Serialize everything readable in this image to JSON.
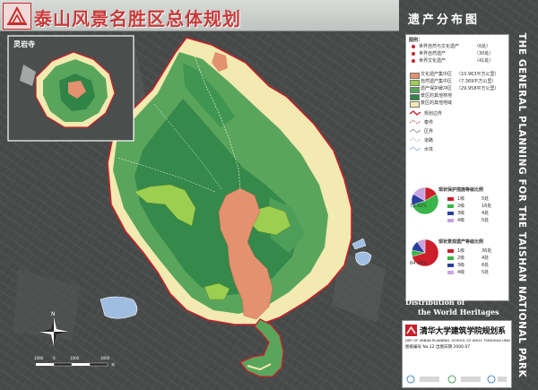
{
  "header": {
    "title": "泰山风景名胜区总体规划",
    "subtitle": "遗产分布图"
  },
  "side_title": "THE GENERAL PLANNING FOR THE TAISHAN NATIONAL PARK",
  "inset": {
    "label": "灵岩寺",
    "temple_label": ""
  },
  "legend": {
    "heading": "图例：",
    "points": [
      {
        "label": "世界自然与文化遗产",
        "count": "（6处）"
      },
      {
        "label": "世界自然遗产",
        "count": "（30处）"
      },
      {
        "label": "世界文化遗产",
        "count": "（41处）"
      }
    ],
    "areas": [
      {
        "label": "文化遗产集中区",
        "value": "（10.963平方公里）",
        "color": "#e3916f"
      },
      {
        "label": "自然遗产集中区",
        "value": "（7.369平方公里）",
        "color": "#9ccf4f"
      },
      {
        "label": "遗产保护缓冲区",
        "value": "（29.958平方公里）",
        "color": "#5aa55c"
      },
      {
        "label": "景区的其他林地",
        "value": "",
        "color": "#2f8446"
      },
      {
        "label": "景区的其他地域",
        "value": "",
        "color": "#f2eab0"
      }
    ],
    "lines": [
      {
        "label": "规划边界",
        "color": "#c8202c"
      },
      {
        "label": "泰界",
        "color": "#b05050"
      },
      {
        "label": "区界",
        "color": "#888888"
      },
      {
        "label": "道路",
        "color": "#999999"
      },
      {
        "label": "水体",
        "color": "#9fbde0"
      }
    ]
  },
  "pie_natural": {
    "title": "现状保护措施等级比例",
    "pct_label_small": "",
    "pct_label_large": "73.42%",
    "rows": [
      {
        "label": "1级",
        "count": "5处",
        "color": "#cc1f2a"
      },
      {
        "label": "2级",
        "count": "16处",
        "color": "#3ab54a"
      },
      {
        "label": "3级",
        "count": "4处",
        "color": "#2b3f9e"
      },
      {
        "label": "4级",
        "count": "5处",
        "color": "#c9a2e0"
      }
    ],
    "slices": [
      0.1667,
      0.5333,
      0.1333,
      0.1667
    ]
  },
  "pie_cultural": {
    "title": "现状景观遗产等级比例",
    "pct_label_small": "",
    "pct_label_large": "64.74%",
    "rows": [
      {
        "label": "1级",
        "count": "36处",
        "color": "#cc1f2a"
      },
      {
        "label": "2级",
        "count": "4处",
        "color": "#3ab54a"
      },
      {
        "label": "3级",
        "count": "6处",
        "color": "#2b3f9e"
      },
      {
        "label": "4级",
        "count": "5处",
        "color": "#c9a2e0"
      }
    ],
    "slices": [
      0.706,
      0.078,
      0.118,
      0.098
    ]
  },
  "caption": {
    "line1": "Distribution of",
    "line2": "the World Heritages"
  },
  "credit": {
    "university": "清华大学建筑学院规划系",
    "department_en": "DEP. OF URBAN PLANNING, SCHOOL OF ARCH. TSINGHUA UNIV",
    "drawing_info": "图纸编号 No.12   出图日期 2000.07"
  },
  "scale": {
    "labels": [
      "1000",
      "0",
      "1000",
      "3000"
    ],
    "unit": "米"
  },
  "colors": {
    "boundary": "#c8202c",
    "forest_dark": "#2f8446",
    "forest_mid": "#5aa55c",
    "buffer": "#6fb26a",
    "natural": "#9ccf4f",
    "cultural": "#e3916f",
    "other": "#f2eab0",
    "water": "#9fbde0"
  }
}
